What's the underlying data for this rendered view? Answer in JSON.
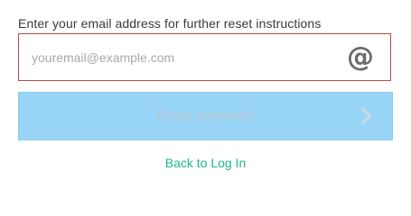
{
  "form": {
    "instruction": "Enter your email address for further reset instructions",
    "email": {
      "value": "",
      "placeholder": "youremail@example.com",
      "icon": "at-icon",
      "border_color": "#b94a48"
    },
    "reset_button": {
      "label": "Reset password",
      "icon": "chevron-right-icon",
      "background": "#99d5f7"
    },
    "back_link": {
      "label": "Back to Log In",
      "color": "#1fb58f"
    }
  }
}
